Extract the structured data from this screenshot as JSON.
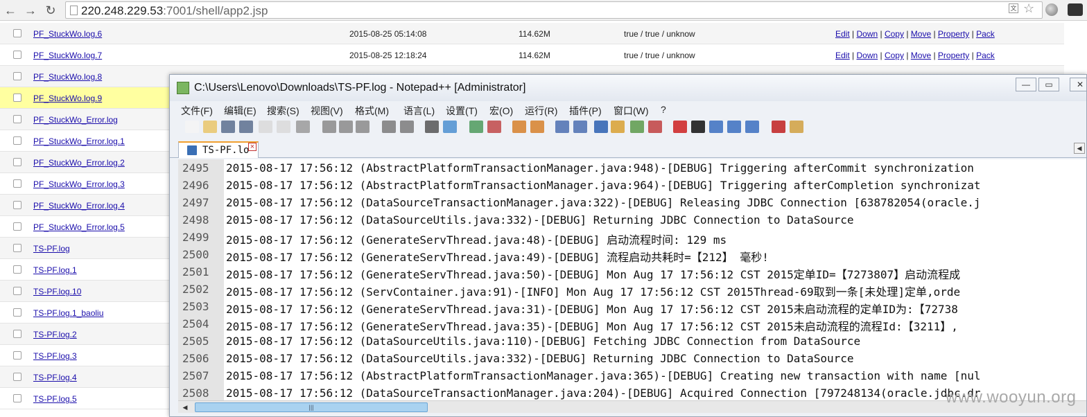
{
  "browser": {
    "url_host": "220.248.229.53",
    "url_rest": ":7001/shell/app2.jsp",
    "back_icon": "arrow-left-icon",
    "forward_icon": "arrow-right-icon",
    "reload_icon": "reload-icon"
  },
  "file_list": {
    "rows": [
      {
        "name": "PF_StuckWo.log.6",
        "date": "2015-08-25 05:14:08",
        "size": "114.62M",
        "perm": "true / true / unknow"
      },
      {
        "name": "PF_StuckWo.log.7",
        "date": "2015-08-25 12:18:24",
        "size": "114.62M",
        "perm": "true / true / unknow"
      },
      {
        "name": "PF_StuckWo.log.8",
        "date": "",
        "size": "",
        "perm": ""
      },
      {
        "name": "PF_StuckWo.log.9",
        "date": "",
        "size": "",
        "perm": ""
      },
      {
        "name": "PF_StuckWo_Error.log",
        "date": "",
        "size": "",
        "perm": ""
      },
      {
        "name": "PF_StuckWo_Error.log.1",
        "date": "",
        "size": "",
        "perm": ""
      },
      {
        "name": "PF_StuckWo_Error.log.2",
        "date": "",
        "size": "",
        "perm": ""
      },
      {
        "name": "PF_StuckWo_Error.log.3",
        "date": "",
        "size": "",
        "perm": ""
      },
      {
        "name": "PF_StuckWo_Error.log.4",
        "date": "",
        "size": "",
        "perm": ""
      },
      {
        "name": "PF_StuckWo_Error.log.5",
        "date": "",
        "size": "",
        "perm": ""
      },
      {
        "name": "TS-PF.log",
        "date": "",
        "size": "",
        "perm": ""
      },
      {
        "name": "TS-PF.log.1",
        "date": "",
        "size": "",
        "perm": ""
      },
      {
        "name": "TS-PF.log.10",
        "date": "",
        "size": "",
        "perm": ""
      },
      {
        "name": "TS-PF.log.1_baoliu",
        "date": "",
        "size": "",
        "perm": ""
      },
      {
        "name": "TS-PF.log.2",
        "date": "",
        "size": "",
        "perm": ""
      },
      {
        "name": "TS-PF.log.3",
        "date": "",
        "size": "",
        "perm": ""
      },
      {
        "name": "TS-PF.log.4",
        "date": "",
        "size": "",
        "perm": ""
      },
      {
        "name": "TS-PF.log.5",
        "date": "",
        "size": "",
        "perm": ""
      }
    ],
    "actions": [
      "Edit",
      "Down",
      "Copy",
      "Move",
      "Property",
      "Pack"
    ],
    "separator": " | "
  },
  "notepad": {
    "title": "C:\\Users\\Lenovo\\Downloads\\TS-PF.log - Notepad++ [Administrator]",
    "window_buttons": {
      "minimize": "—",
      "maximize": "▭",
      "close": "✕"
    },
    "menu": [
      "文件(F)",
      "编辑(E)",
      "搜索(S)",
      "视图(V)",
      "格式(M)",
      "语言(L)",
      "设置(T)",
      "宏(O)",
      "运行(R)",
      "插件(P)",
      "窗口(W)",
      "?"
    ],
    "tab_label": "TS-PF.lo",
    "scroll_arrow": "◀",
    "lines": [
      {
        "n": "2495",
        "t": "2015-08-17 17:56:12 (AbstractPlatformTransactionManager.java:948)-[DEBUG] Triggering afterCommit synchronization"
      },
      {
        "n": "2496",
        "t": "2015-08-17 17:56:12 (AbstractPlatformTransactionManager.java:964)-[DEBUG] Triggering afterCompletion synchronizat"
      },
      {
        "n": "2497",
        "t": "2015-08-17 17:56:12 (DataSourceTransactionManager.java:322)-[DEBUG] Releasing JDBC Connection [638782054(oracle.j"
      },
      {
        "n": "2498",
        "t": "2015-08-17 17:56:12 (DataSourceUtils.java:332)-[DEBUG] Returning JDBC Connection to DataSource"
      },
      {
        "n": "2499",
        "t": "2015-08-17 17:56:12 (GenerateServThread.java:48)-[DEBUG] 启动流程时间: 129 ms"
      },
      {
        "n": "2500",
        "t": "2015-08-17 17:56:12 (GenerateServThread.java:49)-[DEBUG] 流程启动共耗时=【212】 毫秒!"
      },
      {
        "n": "2501",
        "t": "2015-08-17 17:56:12 (GenerateServThread.java:50)-[DEBUG] Mon Aug 17 17:56:12 CST 2015定单ID=【7273807】启动流程成"
      },
      {
        "n": "2502",
        "t": "2015-08-17 17:56:12 (ServContainer.java:91)-[INFO] Mon Aug 17 17:56:12 CST 2015Thread-69取到一条[未处理]定单,orde"
      },
      {
        "n": "2503",
        "t": "2015-08-17 17:56:12 (GenerateServThread.java:31)-[DEBUG] Mon Aug 17 17:56:12 CST 2015未启动流程的定单ID为:【72738"
      },
      {
        "n": "2504",
        "t": "2015-08-17 17:56:12 (GenerateServThread.java:35)-[DEBUG] Mon Aug 17 17:56:12 CST 2015未启动流程的流程Id:【3211】,"
      },
      {
        "n": "2505",
        "t": "2015-08-17 17:56:12 (DataSourceUtils.java:110)-[DEBUG] Fetching JDBC Connection from DataSource"
      },
      {
        "n": "2506",
        "t": "2015-08-17 17:56:12 (DataSourceUtils.java:332)-[DEBUG] Returning JDBC Connection to DataSource"
      },
      {
        "n": "2507",
        "t": "2015-08-17 17:56:12 (AbstractPlatformTransactionManager.java:365)-[DEBUG] Creating new transaction with name [nul"
      },
      {
        "n": "2508",
        "t": "2015-08-17 17:56:12 (DataSourceTransactionManager.java:204)-[DEBUG] Acquired Connection [797248134(oracle.jdbc.dr"
      }
    ]
  },
  "watermark": "www.wooyun.org"
}
